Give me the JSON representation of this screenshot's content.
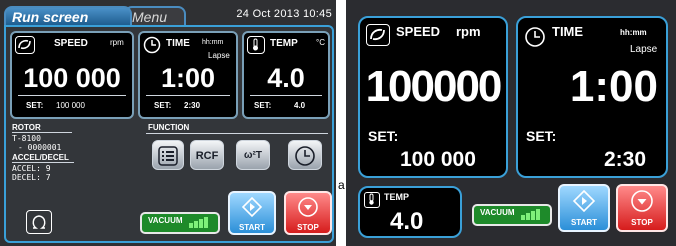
{
  "left": {
    "tabs": {
      "run": "Run screen",
      "menu": "Menu"
    },
    "datetime": "24 Oct 2013 10:45",
    "speed": {
      "title": "SPEED",
      "unit": "rpm",
      "value": "100 000",
      "set_label": "SET:",
      "set_value": "100 000"
    },
    "time": {
      "title": "TIME",
      "unit": "hh:mm",
      "mode": "Lapse",
      "value": "1:00",
      "set_label": "SET:",
      "set_value": "2:30"
    },
    "temp": {
      "title": "TEMP",
      "unit": "°C",
      "value": "4.0",
      "set_label": "SET:",
      "set_value": "4.0"
    },
    "rotor": {
      "title": "ROTOR",
      "model": "T-8100",
      "serial": "- 0000001"
    },
    "accel": {
      "title": "ACCEL/DECEL",
      "accel_line": "ACCEL: 9",
      "decel_line": "DECEL: 7"
    },
    "function": {
      "title": "FUNCTION",
      "rcf_label": "RCF",
      "w2t_label": "ω²T"
    },
    "vacuum_label": "VACUUM",
    "vacuum_level": 4,
    "start_label": "START",
    "stop_label": "STOP"
  },
  "right": {
    "speed": {
      "title": "SPEED",
      "unit": "rpm",
      "value": "100000",
      "set_label": "SET:",
      "set_value": "100 000"
    },
    "time": {
      "title": "TIME",
      "unit": "hh:mm",
      "mode": "Lapse",
      "value": "1:00",
      "set_label": "SET:",
      "set_value": "2:30"
    },
    "temp": {
      "title": "TEMP",
      "value": "4.0"
    },
    "vacuum_label": "VACUUM",
    "vacuum_level": 4,
    "start_label": "START",
    "stop_label": "STOP"
  },
  "side_letter": "a",
  "colors": {
    "accent_blue": "#3aa0d8",
    "start_blue": "#2b8fd8",
    "stop_red": "#d61c1c",
    "vacuum_green": "#1e8a2a"
  }
}
